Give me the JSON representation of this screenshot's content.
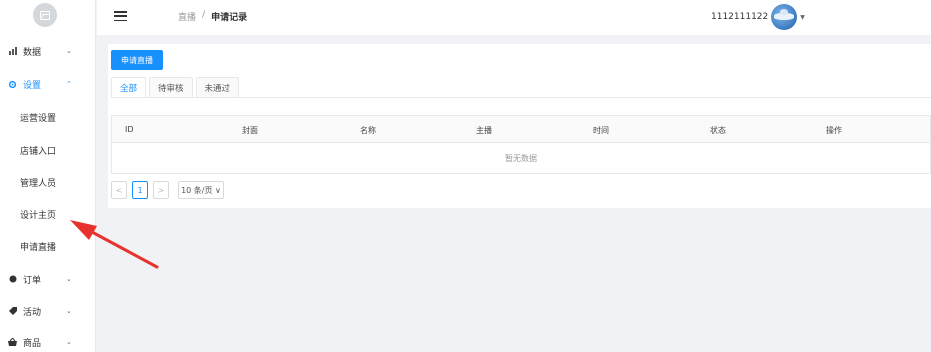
{
  "sidebar": {
    "menu": [
      {
        "label": "数据",
        "icon": "bar-chart-icon",
        "expanded": false
      },
      {
        "label": "设置",
        "icon": "gear-icon",
        "expanded": true
      },
      {
        "label": "订单",
        "icon": "circle-icon",
        "expanded": false
      },
      {
        "label": "活动",
        "icon": "tag-icon",
        "expanded": false
      },
      {
        "label": "商品",
        "icon": "basket-icon",
        "expanded": false
      }
    ],
    "submenu": [
      "运营设置",
      "店铺入口",
      "管理人员",
      "设计主页",
      "申请直播"
    ],
    "arrow_down": "⌄",
    "arrow_up": "⌃"
  },
  "header": {
    "breadcrumb_parent": "直播",
    "breadcrumb_sep": "/",
    "breadcrumb_current": "申请记录",
    "username": "1112111122",
    "caret": "▼"
  },
  "main": {
    "apply_button": "申请直播",
    "tabs": [
      "全部",
      "待审核",
      "未通过"
    ],
    "table": {
      "columns": [
        "ID",
        "封面",
        "名称",
        "主播",
        "时间",
        "状态",
        "操作"
      ],
      "empty_text": "暂无数据"
    },
    "pagination": {
      "prev": "<",
      "current_page": "1",
      "next": ">",
      "page_size": "10 条/页 ∨"
    }
  },
  "colors": {
    "accent": "#1890ff",
    "annotation_arrow": "#e8322e"
  }
}
